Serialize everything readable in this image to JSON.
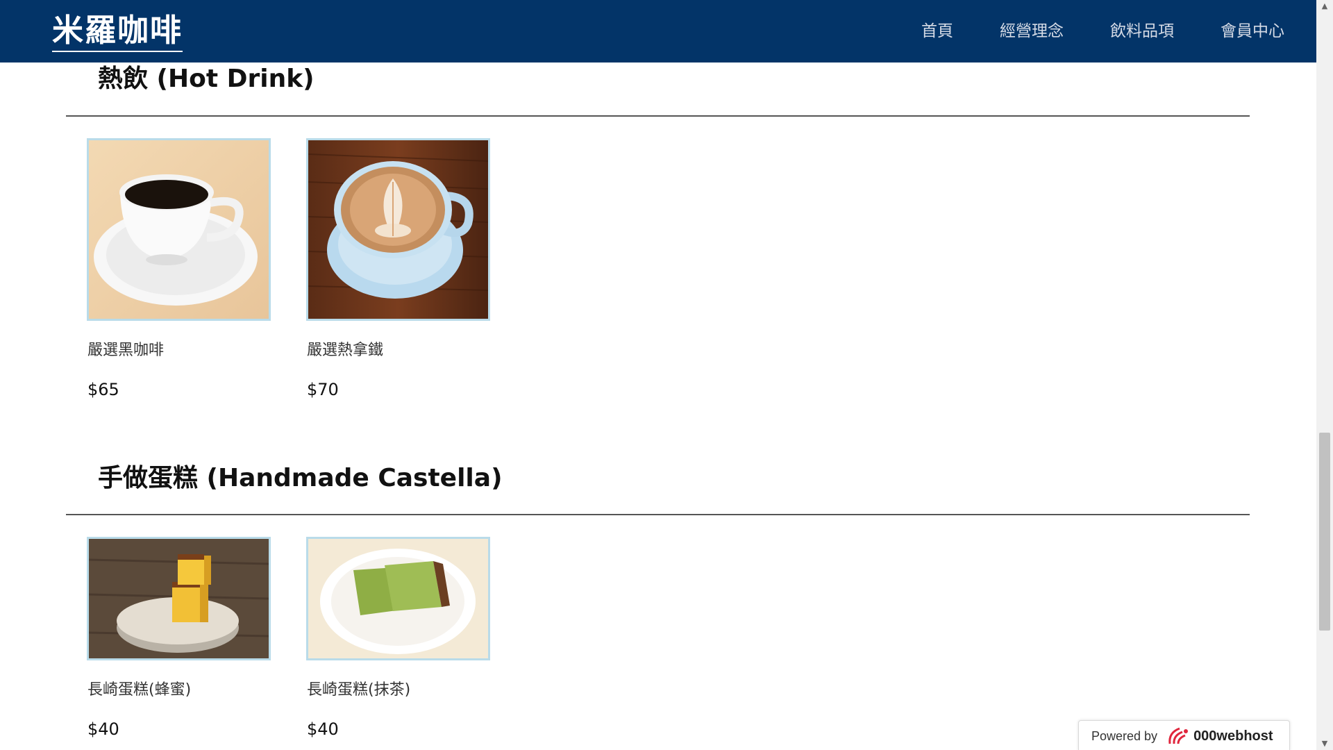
{
  "header": {
    "brand": "米羅咖啡",
    "nav": [
      "首頁",
      "經營理念",
      "飲料品項",
      "會員中心"
    ]
  },
  "sections": [
    {
      "title": "熱飲 (Hot Drink)",
      "items": [
        {
          "name": "嚴選黑咖啡",
          "price": "$65"
        },
        {
          "name": "嚴選熱拿鐵",
          "price": "$70"
        }
      ]
    },
    {
      "title": "手做蛋糕 (Handmade Castella)",
      "items": [
        {
          "name": "長崎蛋糕(蜂蜜)",
          "price": "$40"
        },
        {
          "name": "長崎蛋糕(抹茶)",
          "price": "$40"
        }
      ]
    }
  ],
  "badge": {
    "powered_by": "Powered by",
    "brand": "000webhost"
  },
  "colors": {
    "header_bg": "#033468",
    "thumb_border": "#b9dbe9"
  }
}
